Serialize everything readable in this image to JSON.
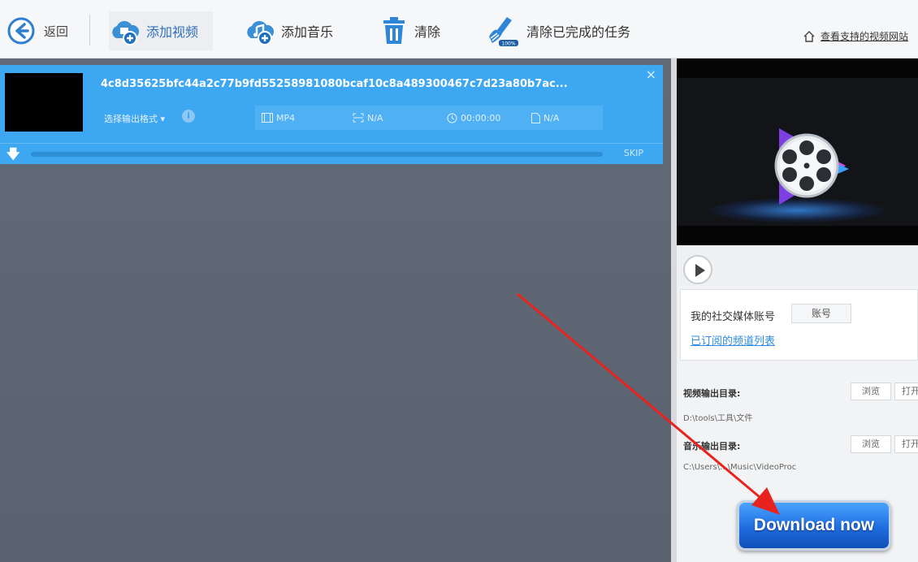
{
  "toolbar": {
    "back_label": "返回",
    "add_video_label": "添加视频",
    "add_music_label": "添加音乐",
    "clear_label": "清除",
    "clear_done_label": "清除已完成的任务",
    "support_link": "查看支持的视频网站"
  },
  "task": {
    "title": "4c8d35625bfc44a2c77b9fd55258981080bcaf10c8a489300467c7d23a80b7ac...",
    "format_select": "选择输出格式 ▾",
    "format": "MP4",
    "resolution": "N/A",
    "duration": "00:00:00",
    "size": "N/A",
    "skip_label": "SKIP",
    "close_symbol": "×",
    "progress": 0
  },
  "right": {
    "social_label": "我的社交媒体账号",
    "account_button": "账号",
    "subscribed_link": "已订阅的频道列表",
    "video_output_label": "视频输出目录:",
    "video_output_path": "D:\\tools\\工具\\文件",
    "music_output_label": "音乐输出目录:",
    "music_output_path": "C:\\Users\\...\\Music\\VideoProc",
    "browse_label": "浏览",
    "open_label": "打开",
    "download_now": "Download now"
  },
  "colors": {
    "task_bar": "#3ea7f1",
    "workspace": "#5f6673",
    "accent_link": "#2f8ce0",
    "annotation_arrow": "#e8231f"
  },
  "icons": [
    "back-icon",
    "add-video-icon",
    "add-music-icon",
    "trash-icon",
    "clear-done-icon",
    "home-icon",
    "close-icon",
    "info-icon",
    "film-icon",
    "resolution-icon",
    "clock-icon",
    "file-icon",
    "download-arrow-icon",
    "play-icon",
    "videoproc-logo-icon"
  ]
}
